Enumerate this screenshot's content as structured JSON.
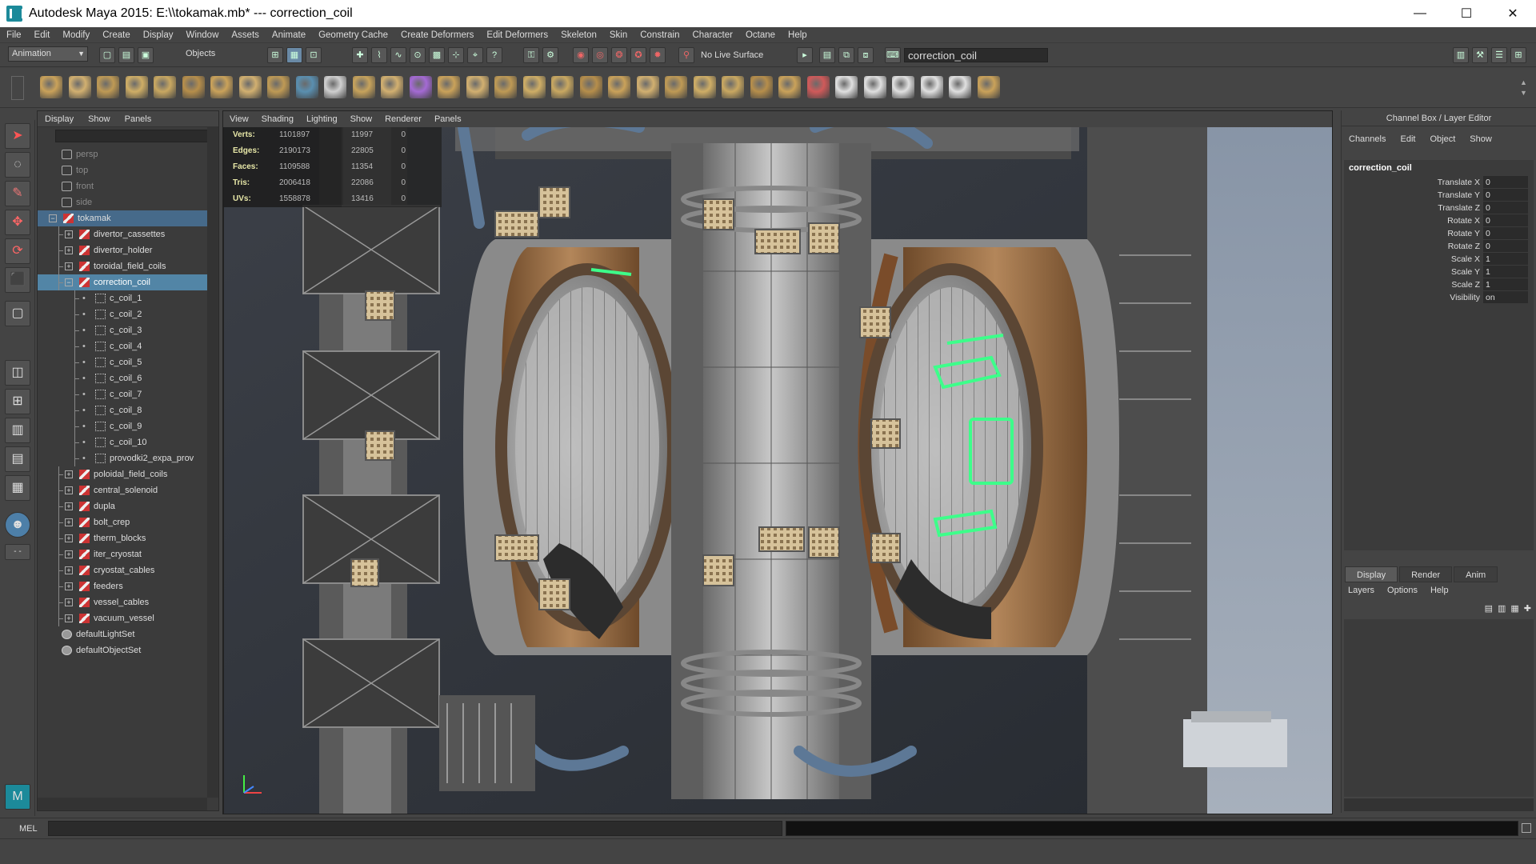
{
  "window": {
    "title": "Autodesk Maya 2015: E:\\\\tokamak.mb*   ---   correction_coil",
    "minimize": "—",
    "maximize": "☐",
    "close": "✕"
  },
  "menubar": [
    "File",
    "Edit",
    "Modify",
    "Create",
    "Display",
    "Window",
    "Assets",
    "Animate",
    "Geometry Cache",
    "Create Deformers",
    "Edit Deformers",
    "Skeleton",
    "Skin",
    "Constrain",
    "Character",
    "Octane",
    "Help"
  ],
  "statusline": {
    "menuset": "Animation",
    "selection_mode": "Objects",
    "live_surface": "No Live Surface",
    "name_field": "correction_coil"
  },
  "outliner": {
    "menu": [
      "Display",
      "Show",
      "Panels"
    ],
    "items": [
      {
        "label": "persp",
        "type": "cam",
        "indent": 0,
        "dim": true
      },
      {
        "label": "top",
        "type": "cam",
        "indent": 0,
        "dim": true
      },
      {
        "label": "front",
        "type": "cam",
        "indent": 0,
        "dim": true
      },
      {
        "label": "side",
        "type": "cam",
        "indent": 0,
        "dim": true
      },
      {
        "label": "tokamak",
        "type": "tr",
        "indent": 0,
        "exp": "−",
        "sel": "sel2"
      },
      {
        "label": "divertor_cassettes",
        "type": "tr",
        "indent": 1,
        "exp": "+"
      },
      {
        "label": "divertor_holder",
        "type": "tr",
        "indent": 1,
        "exp": "+"
      },
      {
        "label": "toroidal_field_coils",
        "type": "tr",
        "indent": 1,
        "exp": "+"
      },
      {
        "label": "correction_coil",
        "type": "tr",
        "indent": 1,
        "exp": "−",
        "sel": "sel"
      },
      {
        "label": "c_coil_1",
        "type": "mesh",
        "indent": 2
      },
      {
        "label": "c_coil_2",
        "type": "mesh",
        "indent": 2
      },
      {
        "label": "c_coil_3",
        "type": "mesh",
        "indent": 2
      },
      {
        "label": "c_coil_4",
        "type": "mesh",
        "indent": 2
      },
      {
        "label": "c_coil_5",
        "type": "mesh",
        "indent": 2
      },
      {
        "label": "c_coil_6",
        "type": "mesh",
        "indent": 2
      },
      {
        "label": "c_coil_7",
        "type": "mesh",
        "indent": 2
      },
      {
        "label": "c_coil_8",
        "type": "mesh",
        "indent": 2
      },
      {
        "label": "c_coil_9",
        "type": "mesh",
        "indent": 2
      },
      {
        "label": "c_coil_10",
        "type": "mesh",
        "indent": 2
      },
      {
        "label": "provodki2_expa_prov",
        "type": "mesh",
        "indent": 2
      },
      {
        "label": "poloidal_field_coils",
        "type": "tr",
        "indent": 1,
        "exp": "+"
      },
      {
        "label": "central_solenoid",
        "type": "tr",
        "indent": 1,
        "exp": "+"
      },
      {
        "label": "dupla",
        "type": "tr",
        "indent": 1,
        "exp": "+"
      },
      {
        "label": "bolt_crep",
        "type": "tr",
        "indent": 1,
        "exp": "+"
      },
      {
        "label": "therm_blocks",
        "type": "tr",
        "indent": 1,
        "exp": "+"
      },
      {
        "label": "iter_cryostat",
        "type": "tr",
        "indent": 1,
        "exp": "+"
      },
      {
        "label": "cryostat_cables",
        "type": "tr",
        "indent": 1,
        "exp": "+"
      },
      {
        "label": "feeders",
        "type": "tr",
        "indent": 1,
        "exp": "+"
      },
      {
        "label": "vessel_cables",
        "type": "tr",
        "indent": 1,
        "exp": "+"
      },
      {
        "label": "vacuum_vessel",
        "type": "tr",
        "indent": 1,
        "exp": "+"
      },
      {
        "label": "defaultLightSet",
        "type": "set",
        "indent": 0
      },
      {
        "label": "defaultObjectSet",
        "type": "set",
        "indent": 0
      }
    ]
  },
  "viewport": {
    "menu": [
      "View",
      "Shading",
      "Lighting",
      "Show",
      "Renderer",
      "Panels"
    ],
    "hud": [
      {
        "k": "Verts:",
        "v1": "1101897",
        "v2": "11997",
        "v3": "0"
      },
      {
        "k": "Edges:",
        "v1": "2190173",
        "v2": "22805",
        "v3": "0"
      },
      {
        "k": "Faces:",
        "v1": "1109588",
        "v2": "11354",
        "v3": "0"
      },
      {
        "k": "Tris:",
        "v1": "2006418",
        "v2": "22086",
        "v3": "0"
      },
      {
        "k": "UVs:",
        "v1": "1558878",
        "v2": "13416",
        "v3": "0"
      }
    ]
  },
  "channelbox": {
    "title": "Channel Box / Layer Editor",
    "menu": [
      "Channels",
      "Edit",
      "Object",
      "Show"
    ],
    "object": "correction_coil",
    "channels": [
      {
        "l": "Translate X",
        "v": "0"
      },
      {
        "l": "Translate Y",
        "v": "0"
      },
      {
        "l": "Translate Z",
        "v": "0"
      },
      {
        "l": "Rotate X",
        "v": "0"
      },
      {
        "l": "Rotate Y",
        "v": "0"
      },
      {
        "l": "Rotate Z",
        "v": "0"
      },
      {
        "l": "Scale X",
        "v": "1"
      },
      {
        "l": "Scale Y",
        "v": "1"
      },
      {
        "l": "Scale Z",
        "v": "1"
      },
      {
        "l": "Visibility",
        "v": "on"
      }
    ]
  },
  "layereditor": {
    "tabs": [
      "Display",
      "Render",
      "Anim"
    ],
    "menu": [
      "Layers",
      "Options",
      "Help"
    ]
  },
  "cmdline": {
    "label": "MEL"
  },
  "colors": {
    "selection": "#5285a6",
    "accent_green": "#3dff8a",
    "copper": "#9a6a3e"
  }
}
